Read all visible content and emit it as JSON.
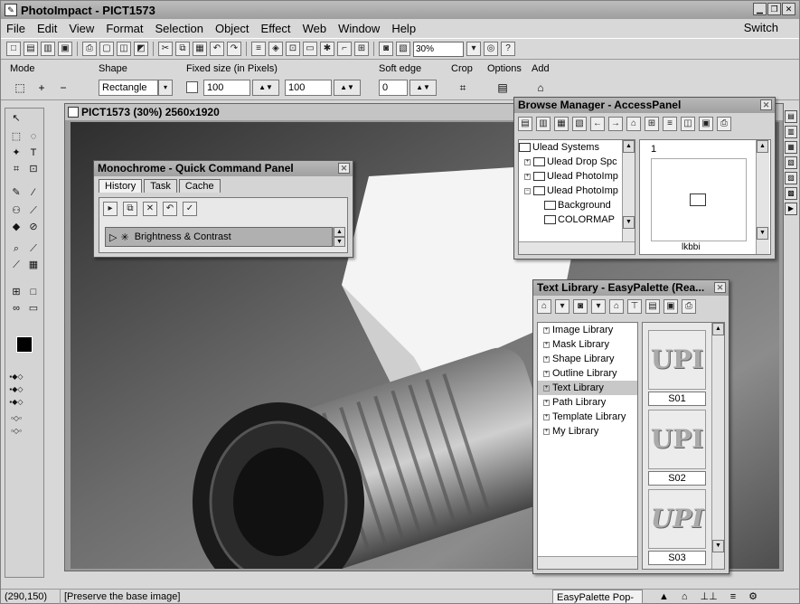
{
  "window": {
    "title": "PhotoImpact - PICT1573"
  },
  "menu": {
    "items": [
      "File",
      "Edit",
      "View",
      "Format",
      "Selection",
      "Object",
      "Effect",
      "Web",
      "Window",
      "Help"
    ],
    "switch": "Switch"
  },
  "toolbar": {
    "zoom": "30%"
  },
  "attributes": {
    "mode_label": "Mode",
    "shape_label": "Shape",
    "shape_value": "Rectangle",
    "fixed_label": "Fixed size (in Pixels)",
    "width": "100",
    "height": "100",
    "softedge_label": "Soft edge",
    "softedge_value": "0",
    "crop_label": "Crop",
    "options_label": "Options",
    "add_label": "Add"
  },
  "document": {
    "title": "PICT1573 (30%) 2560x1920"
  },
  "quick_panel": {
    "title": "Monochrome - Quick Command Panel",
    "tabs": [
      "History",
      "Task",
      "Cache"
    ],
    "entry": "Brightness & Contrast"
  },
  "browse": {
    "title": "Browse Manager - AccessPanel",
    "tree": [
      "Ulead Systems",
      "Ulead Drop Spc",
      "Ulead PhotoImp",
      "Ulead PhotoImp",
      "Background",
      "COLORMAP"
    ],
    "thumb_index": "1",
    "thumb_label": "lkbbi"
  },
  "library": {
    "title": "Text Library - EasyPalette (Rea...",
    "items": [
      "Image Library",
      "Mask Library",
      "Shape Library",
      "Outline Library",
      "Text Library",
      "Path Library",
      "Template Library",
      "My Library"
    ],
    "thumb_text": "UPI",
    "captions": [
      "S01",
      "S02",
      "S03"
    ]
  },
  "status": {
    "coords": "(290,150)",
    "message": "[Preserve the base image]",
    "popup": "EasyPalette Pop-up"
  }
}
